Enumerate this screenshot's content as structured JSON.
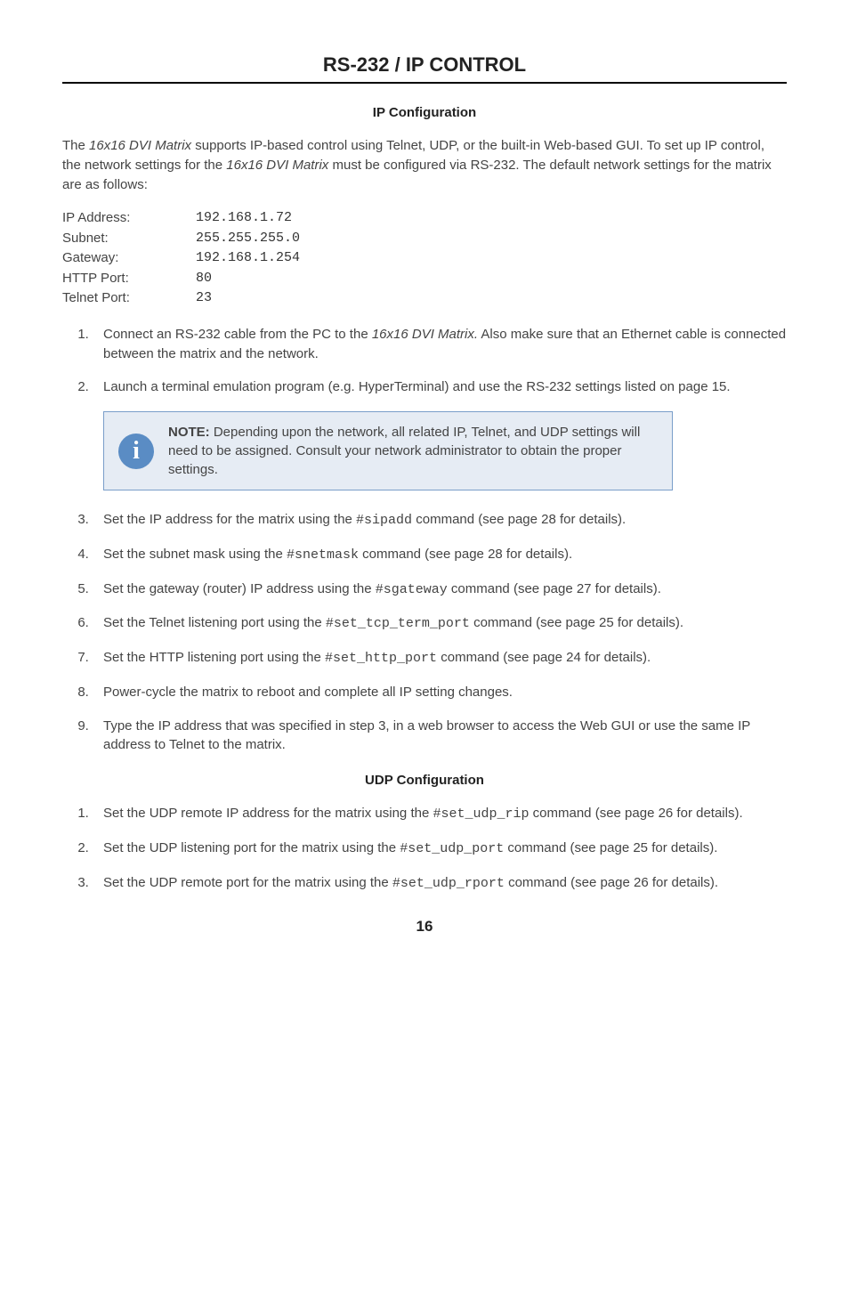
{
  "header": {
    "title": "RS-232 / IP CONTROL"
  },
  "ipconfig": {
    "heading": "IP Configuration",
    "intro_pre": "The ",
    "intro_product1": "16x16 DVI Matrix",
    "intro_mid1": " supports IP-based control using Telnet, UDP, or the built-in Web-based GUI.  To set up IP control, the network settings for the ",
    "intro_product2": "16x16 DVI Matrix",
    "intro_post": " must be configured via RS-232.  The default network settings for the matrix are as follows:",
    "rows": {
      "ip_label": "IP Address:",
      "ip_val": "192.168.1.72",
      "sn_label": "Subnet:",
      "sn_val": "255.255.255.0",
      "gw_label": "Gateway:",
      "gw_val": "192.168.1.254",
      "http_label": "HTTP Port:",
      "http_val": "80",
      "tel_label": "Telnet Port:",
      "tel_val": "23"
    },
    "steps1": {
      "s1a": "Connect an RS-232 cable from the PC to the ",
      "s1b": "16x16 DVI Matrix.",
      "s1c": "  Also make sure that an Ethernet cable is connected between the matrix and the network.",
      "s2": "Launch a terminal emulation program (e.g. HyperTerminal) and use the RS-232 settings listed on page 15."
    },
    "note": {
      "label": "NOTE:",
      "text": " Depending upon the network, all related IP, Telnet, and UDP settings will need to be assigned.  Consult your network administrator to obtain the proper settings."
    },
    "steps2": {
      "s3a": "Set the IP address for the matrix using the ",
      "s3cmd": "#sipadd",
      "s3b": " command (see page 28 for details).",
      "s4a": "Set the subnet mask using the ",
      "s4cmd": "#snetmask",
      "s4b": " command (see page 28 for details).",
      "s5a": "Set the gateway (router) IP address using the ",
      "s5cmd": "#sgateway",
      "s5b": " command (see page 27 for details).",
      "s6a": "Set the Telnet listening port using the ",
      "s6cmd": "#set_tcp_term_port",
      "s6b": " command (see page 25 for details).",
      "s7a": "Set the HTTP listening port using the ",
      "s7cmd": "#set_http_port",
      "s7b": " command (see page 24 for details).",
      "s8": "Power-cycle the matrix to reboot and complete all IP setting changes.",
      "s9": "Type the IP address that was specified in step 3, in a web browser to access the Web GUI or use the same IP address to Telnet to the matrix."
    }
  },
  "udpconfig": {
    "heading": "UDP Configuration",
    "s1a": "Set the UDP remote IP address for the matrix using the ",
    "s1cmd": "#set_udp_rip",
    "s1b": " command (see page 26 for details).",
    "s2a": "Set the UDP listening port for the matrix using the ",
    "s2cmd": "#set_udp_port",
    "s2b": " command (see page 25 for details).",
    "s3a": "Set the UDP remote port for the matrix using the ",
    "s3cmd": "#set_udp_rport",
    "s3b": " command (see page 26 for details)."
  },
  "page_number": "16"
}
